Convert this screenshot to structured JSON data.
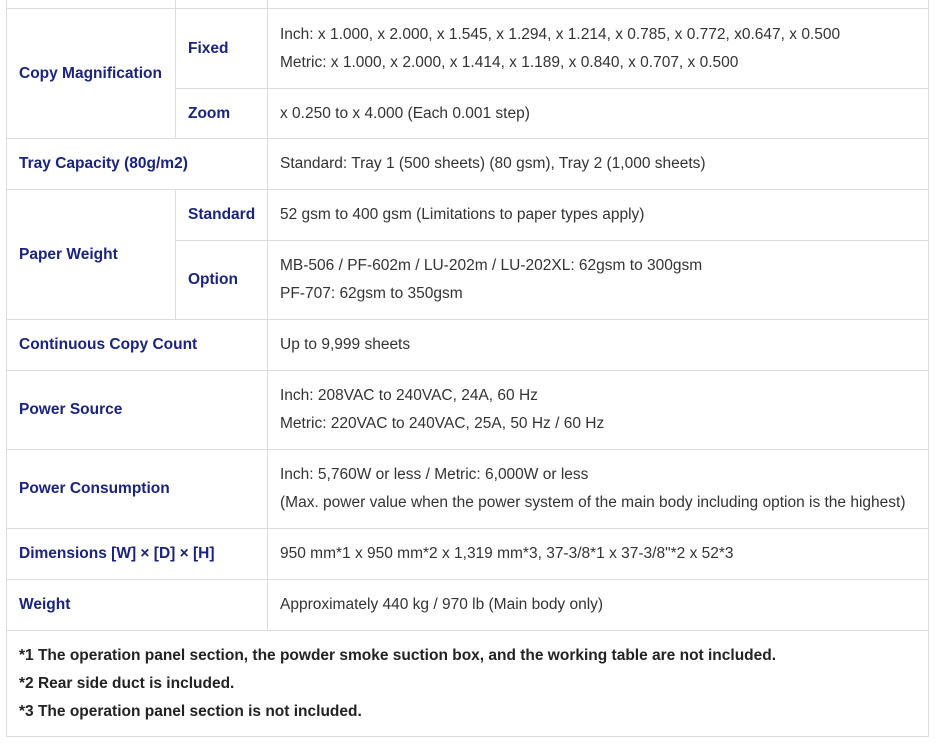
{
  "rows": {
    "copy_magnification": {
      "label": "Copy Magnification",
      "fixed_label": "Fixed",
      "fixed_inch": "Inch: x 1.000, x 2.000, x 1.545, x 1.294, x 1.214, x 0.785, x 0.772, x0.647, x 0.500",
      "fixed_metric": "Metric: x 1.000, x 2.000, x 1.414, x 1.189, x 0.840, x 0.707, x 0.500",
      "zoom_label": "Zoom",
      "zoom_value": "x 0.250 to x 4.000 (Each 0.001 step)"
    },
    "tray_capacity": {
      "label": "Tray Capacity (80g/m2)",
      "value": "Standard: Tray 1 (500 sheets) (80 gsm), Tray 2 (1,000 sheets)"
    },
    "paper_weight": {
      "label": "Paper Weight",
      "standard_label": "Standard",
      "standard_value": "52 gsm to 400 gsm (Limitations to paper types apply)",
      "option_label": "Option",
      "option_line1": "MB-506 / PF-602m / LU-202m / LU-202XL: 62gsm to 300gsm",
      "option_line2": "PF-707: 62gsm to 350gsm"
    },
    "continuous_copy": {
      "label": "Continuous Copy Count",
      "value": "Up to 9,999 sheets"
    },
    "power_source": {
      "label": "Power Source",
      "line1": "Inch: 208VAC to 240VAC, 24A, 60 Hz",
      "line2": "Metric: 220VAC to 240VAC, 25A, 50 Hz / 60 Hz"
    },
    "power_consumption": {
      "label": "Power Consumption",
      "line1": "Inch: 5,760W or less / Metric: 6,000W or less",
      "line2": "(Max. power value when the power system of the main body including option is the highest)"
    },
    "dimensions": {
      "label": "Dimensions [W] × [D] × [H]",
      "value": "950 mm*1 x 950 mm*2 x 1,319 mm*3, 37-3/8*1 x 37-3/8\"*2 x 52*3"
    },
    "weight": {
      "label": "Weight",
      "value": "Approximately 440 kg / 970 lb (Main body only)"
    }
  },
  "notes": [
    "*1 The operation panel section, the powder smoke suction box, and the working table are not included.",
    "*2 Rear side duct is included.",
    "*3 The operation panel section is not included."
  ]
}
